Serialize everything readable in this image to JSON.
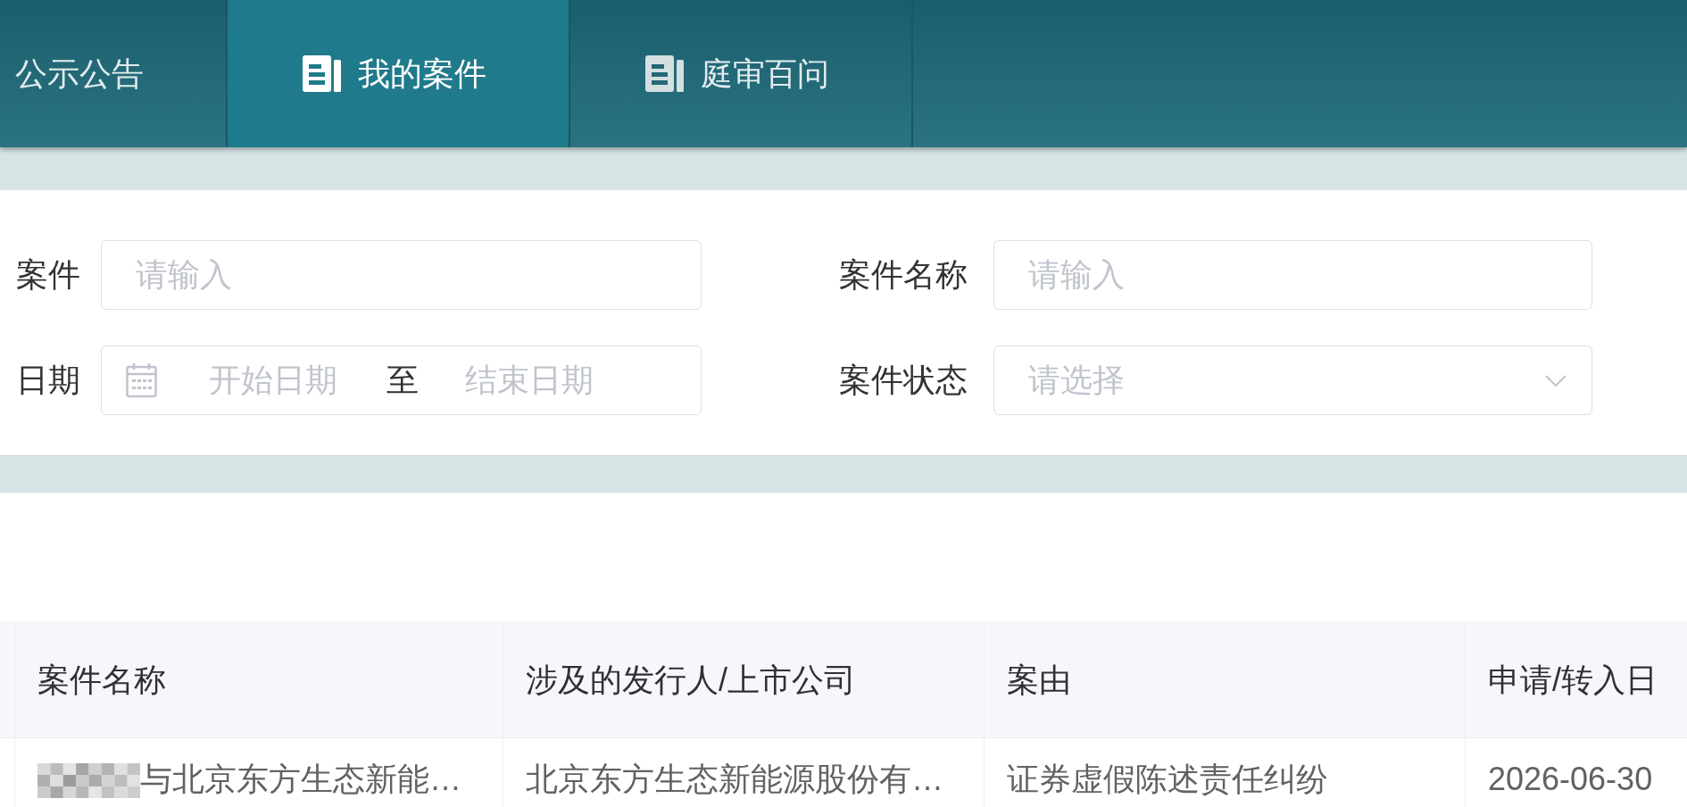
{
  "nav": {
    "tabs": [
      {
        "label": "公示公告",
        "icon": false,
        "selected": false
      },
      {
        "label": "我的案件",
        "icon": true,
        "selected": true
      },
      {
        "label": "庭审百问",
        "icon": true,
        "selected": false
      }
    ]
  },
  "filters": [
    {
      "kind": "text",
      "label": "案件",
      "placeholder": "请输入"
    },
    {
      "kind": "text",
      "label": "案件名称",
      "placeholder": "请输入"
    },
    {
      "kind": "date_range",
      "label": "日期",
      "start_placeholder": "开始日期",
      "separator": "至",
      "end_placeholder": "结束日期"
    },
    {
      "kind": "select",
      "label": "案件状态",
      "placeholder": "请选择"
    }
  ],
  "table": {
    "columns": [
      "案件名称",
      "涉及的发行人/上市公司",
      "案由",
      "申请/转入日"
    ],
    "rows": [
      {
        "cells": [
          {
            "text": "与北京东方生态新能…",
            "redacted": true
          },
          {
            "text": "北京东方生态新能源股份有…",
            "redacted": false
          },
          {
            "text": "证券虚假陈述责任纠纷",
            "redacted": false
          },
          {
            "text": "2026-06-30",
            "redacted": false
          }
        ]
      }
    ]
  }
}
